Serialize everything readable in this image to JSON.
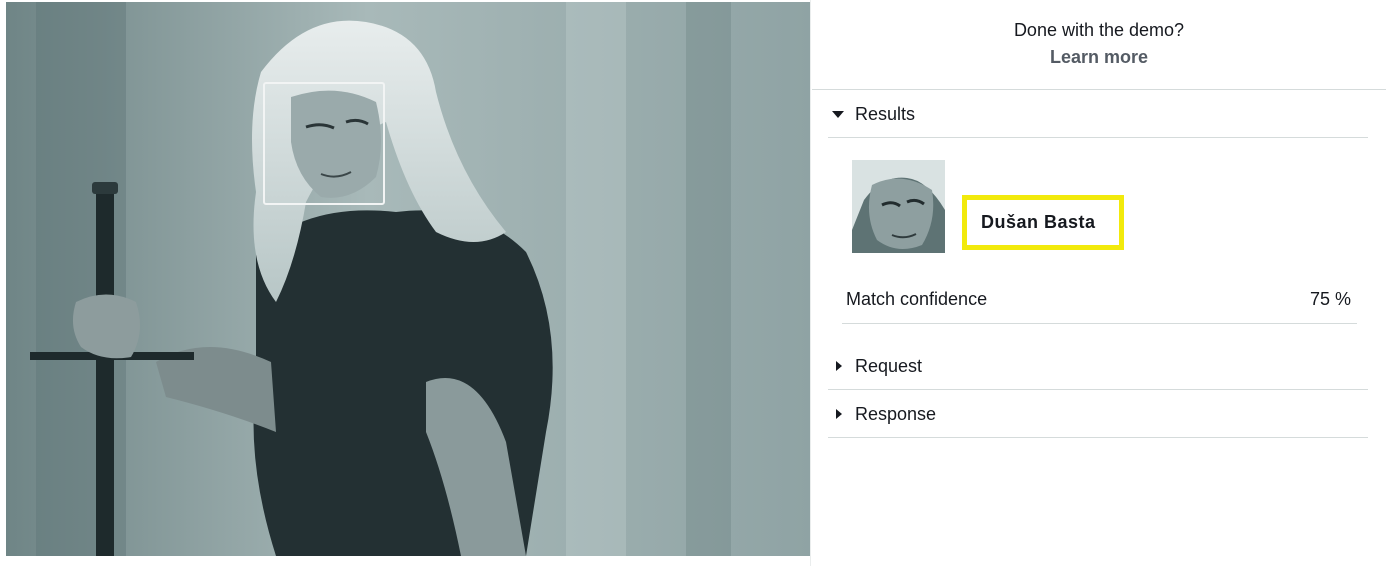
{
  "demo": {
    "prompt": "Done with the demo?",
    "link_label": "Learn more"
  },
  "results": {
    "section_label": "Results",
    "expanded": true,
    "celebrity_name": "Dušan Basta",
    "confidence_label": "Match confidence",
    "confidence_value": "75 %"
  },
  "request": {
    "section_label": "Request",
    "expanded": false
  },
  "response": {
    "section_label": "Response",
    "expanded": false
  },
  "colors": {
    "highlight": "#f2ea0c",
    "link": "#545b64",
    "divider": "#d5dbdb",
    "photo_tint": "#7f9596"
  }
}
